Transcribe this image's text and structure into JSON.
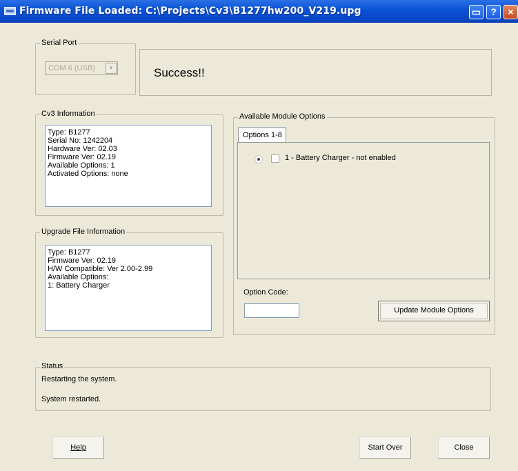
{
  "window": {
    "title": "Firmware File Loaded: C:\\Projects\\Cv3\\B1277hw200_V219.upg",
    "controls": {
      "restore": "▭",
      "help": "?",
      "close": "×"
    }
  },
  "serial_port": {
    "label": "Serial Port",
    "combo_value": "COM 6 (USB)",
    "combo_arrow": "▼"
  },
  "result": {
    "message": "Success!!"
  },
  "cv3_info": {
    "label": "Cv3 Information",
    "lines": [
      "Type: B1277",
      "Serial No: 1242204",
      "Hardware Ver: 02.03",
      "Firmware Ver: 02.19",
      "Available Options: 1",
      "Activated Options: none"
    ]
  },
  "upgrade_info": {
    "label": "Upgrade File Information",
    "lines": [
      "Type: B1277",
      "Firmware Ver: 02.19",
      "H/W Compatible: Ver 2.00-2.99",
      "Available Options:",
      "1: Battery Charger"
    ]
  },
  "module_options": {
    "label": "Available Module Options",
    "tab": "Options 1-8",
    "items": [
      {
        "label": "1 - Battery Charger - not enabled",
        "checked": false,
        "selected": true
      }
    ],
    "option_code_label": "Option Code:",
    "option_code_value": "",
    "update_button": "Update Module Options"
  },
  "status": {
    "label": "Status",
    "lines": [
      "Restarting the system.",
      "System restarted."
    ]
  },
  "buttons": {
    "help": "Help",
    "start_over": "Start Over",
    "close": "Close"
  }
}
